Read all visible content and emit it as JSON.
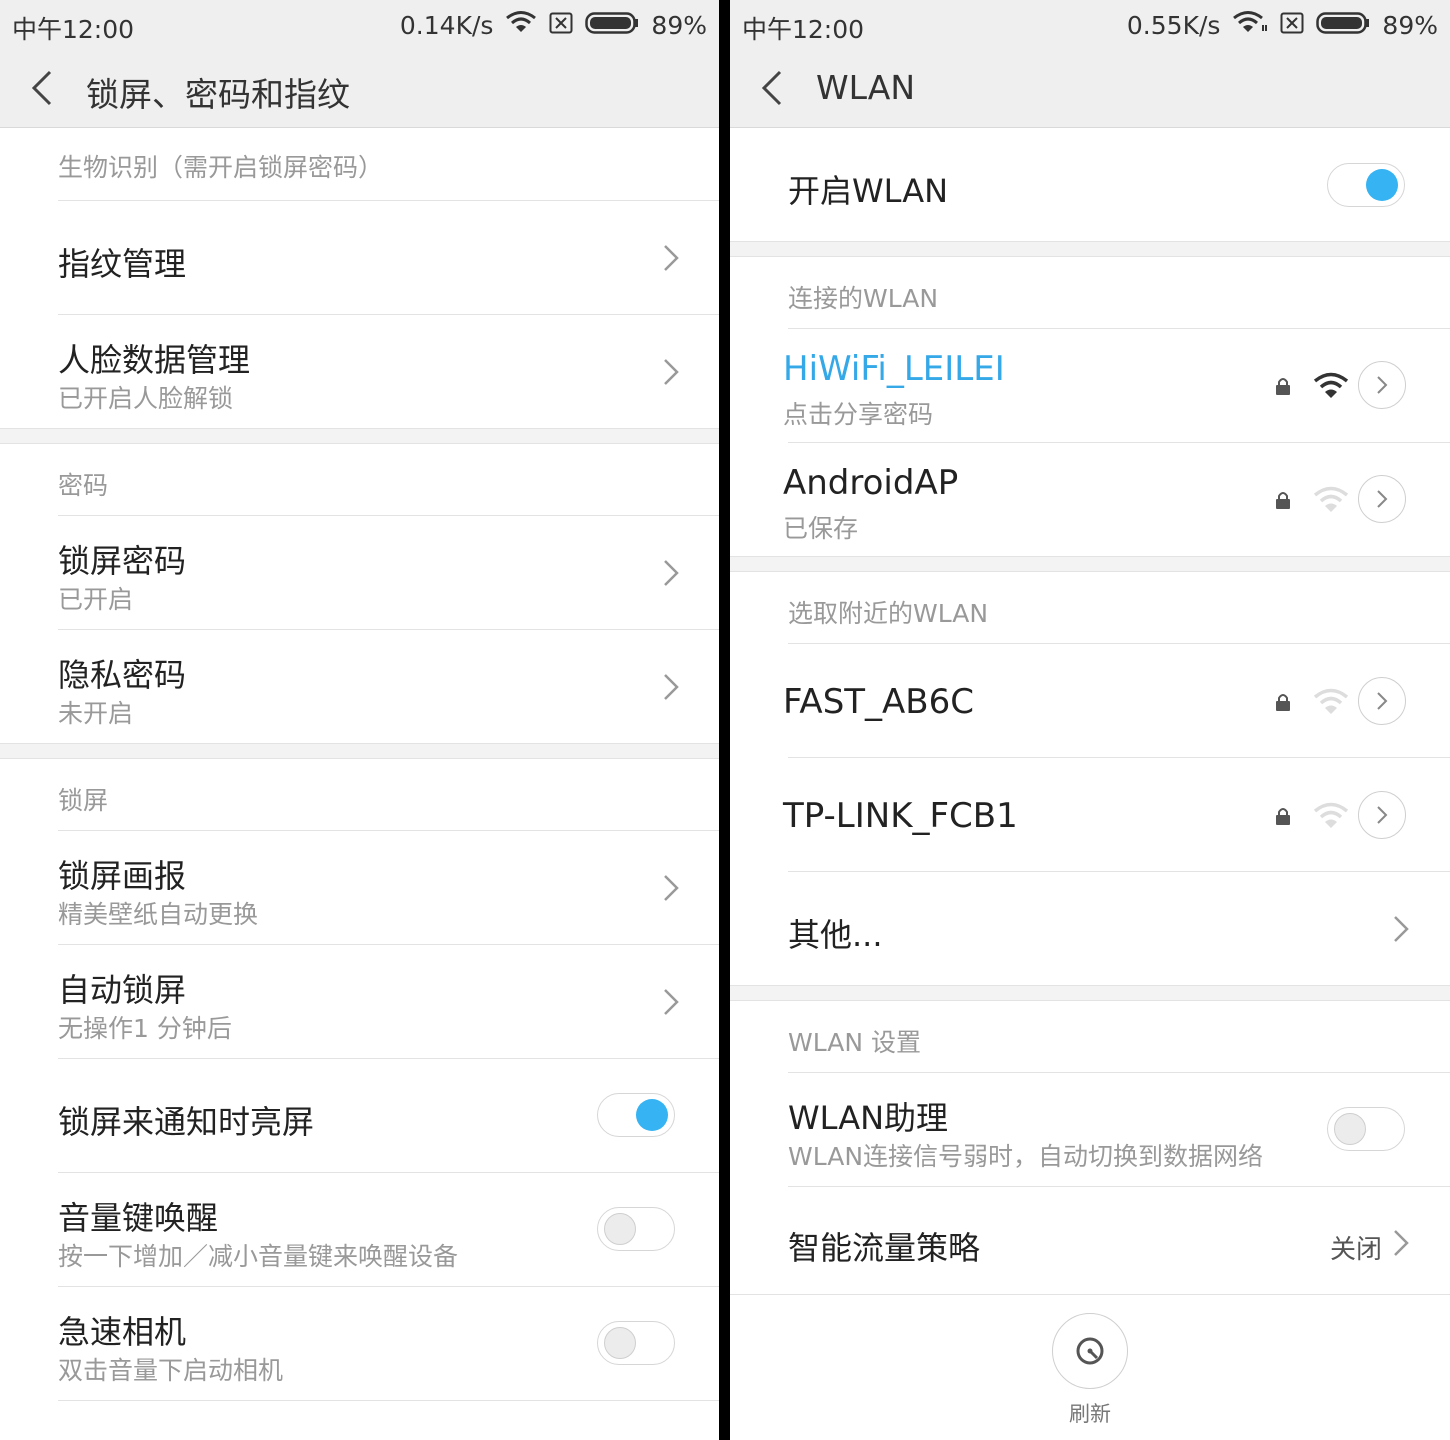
{
  "left": {
    "status": {
      "time": "中午12:00",
      "speed": "0.14K/s",
      "battery": "89%"
    },
    "title": "锁屏、密码和指纹",
    "sections": [
      {
        "header": "生物识别（需开启锁屏密码）"
      },
      {
        "header": "密码"
      },
      {
        "header": "锁屏"
      }
    ],
    "items": {
      "fingerprint": {
        "label": "指纹管理"
      },
      "face": {
        "label": "人脸数据管理",
        "sub": "已开启人脸解锁"
      },
      "lock_password": {
        "label": "锁屏密码",
        "sub": "已开启"
      },
      "privacy_password": {
        "label": "隐私密码",
        "sub": "未开启"
      },
      "lock_wallpaper": {
        "label": "锁屏画报",
        "sub": "精美壁纸自动更换"
      },
      "auto_lock": {
        "label": "自动锁屏",
        "sub": "无操作1 分钟后"
      },
      "wake_on_notify": {
        "label": "锁屏来通知时亮屏",
        "on": true
      },
      "volume_wake": {
        "label": "音量键唤醒",
        "sub": "按一下增加／减小音量键来唤醒设备",
        "on": false
      },
      "quick_camera": {
        "label": "急速相机",
        "sub": "双击音量下启动相机",
        "on": false
      }
    }
  },
  "right": {
    "status": {
      "time": "中午12:00",
      "speed": "0.55K/s",
      "battery": "89%"
    },
    "title": "WLAN",
    "wlan_toggle": {
      "label": "开启WLAN",
      "on": true
    },
    "connected_header": "连接的WLAN",
    "connected": [
      {
        "name": "HiWiFi_LEILEI",
        "sub": "点击分享密码",
        "color": "#35a8e8"
      },
      {
        "name": "AndroidAP",
        "sub": "已保存"
      }
    ],
    "nearby_header": "选取附近的WLAN",
    "nearby": [
      {
        "name": "FAST_AB6C"
      },
      {
        "name": "TP-LINK_FCB1"
      }
    ],
    "other_label": "其他...",
    "settings_header": "WLAN 设置",
    "assistant": {
      "label": "WLAN助理",
      "sub": "WLAN连接信号弱时，自动切换到数据网络",
      "on": false
    },
    "smart_traffic": {
      "label": "智能流量策略",
      "value": "关闭"
    },
    "refresh_label": "刷新"
  },
  "colors": {
    "accent": "#35b3f3",
    "connected": "#35a8e8"
  }
}
